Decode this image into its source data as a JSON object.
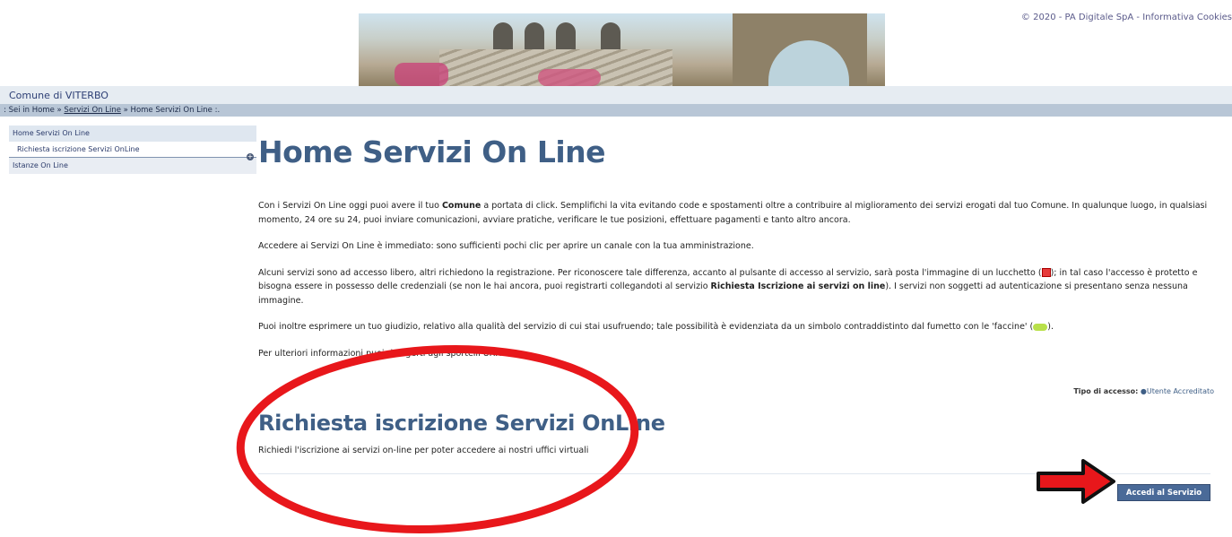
{
  "header": {
    "copyright": "© 2020 - PA Digitale SpA - Informativa Cookies"
  },
  "comune": {
    "name": "Comune di VITERBO"
  },
  "breadcrumb": {
    "prefix": ": Sei in Home » ",
    "link": "Servizi On Line",
    "suffix": " » Home Servizi On Line :."
  },
  "sidebar": {
    "items": [
      {
        "label": "Home Servizi On Line"
      },
      {
        "label": "Richiesta iscrizione Servizi OnLine"
      },
      {
        "label": "Istanze On Line"
      }
    ],
    "expand_icon": "plus-circle-icon"
  },
  "main": {
    "title": "Home Servizi On Line",
    "p1_a": "Con i Servizi On Line oggi puoi avere il tuo ",
    "p1_b": "Comune",
    "p1_c": " a portata di click. Semplifichi la vita evitando code e spostamenti oltre a contribuire al miglioramento dei servizi erogati dal tuo Comune. In qualunque luogo, in qualsiasi momento, 24 ore su 24, puoi inviare comunicazioni, avviare pratiche, verificare le tue posizioni, effettuare pagamenti e tanto altro ancora.",
    "p2": "Accedere ai Servizi On Line è immediato: sono sufficienti pochi clic per aprire un canale con la tua amministrazione.",
    "p3_a": "Alcuni servizi sono ad accesso libero, altri richiedono la registrazione. Per riconoscere tale differenza, accanto al pulsante di accesso al servizio, sarà posta l'immagine di un lucchetto (",
    "p3_b": "); in tal caso l'accesso è protetto e bisogna essere in possesso delle credenziali (se non le hai ancora, puoi registrarti collegandoti al servizio ",
    "p3_c": "Richiesta Iscrizione ai servizi on line",
    "p3_d": "). I servizi non soggetti ad autenticazione si presentano senza nessuna immagine.",
    "p4_a": "Puoi inoltre esprimere un tuo giudizio, relativo alla qualità del servizio di cui stai usufruendo; tale possibilità è evidenziata da un simbolo contraddistinto dal fumetto con le 'faccine' (",
    "p4_b": ").",
    "p5": "Per ulteriori informazioni puoi rivolgerti agli sportelli URP.",
    "access_label": "Tipo di accesso:",
    "access_value": "Utente Accreditato",
    "service_title": "Richiesta iscrizione Servizi OnLine",
    "service_desc": "Richiedi l'iscrizione ai servizi on-line per poter accedere ai nostri uffici virtuali",
    "service_button": "Accedi al Servizio"
  },
  "colors": {
    "accent": "#3f5f86",
    "annotation": "#e8171b"
  }
}
